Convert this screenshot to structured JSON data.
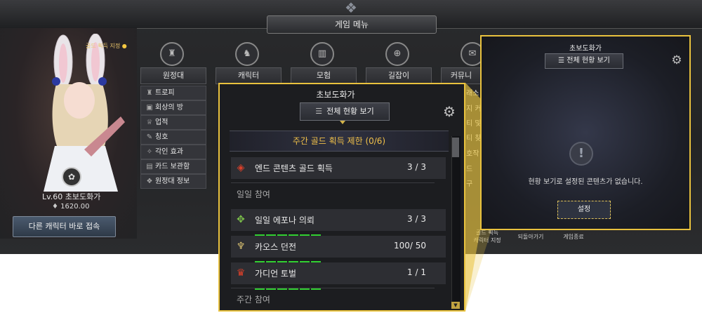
{
  "game_menu": {
    "title": "게임 메뉴",
    "gold_label": "골드 획득 지정",
    "character": {
      "level": "Lv.60 초보도화가",
      "gold": "1620.00",
      "switch_button": "다른 캐릭터 바로 접속"
    },
    "categories": [
      {
        "label": "원정대",
        "icon": "trophy-icon"
      },
      {
        "label": "캐릭터",
        "icon": "helmet-icon"
      },
      {
        "label": "모험",
        "icon": "book-icon"
      },
      {
        "label": "길잡이",
        "icon": "compass-icon"
      },
      {
        "label": "커뮤니",
        "icon": "chat-icon"
      }
    ],
    "expedition_items": [
      {
        "label": "트로피",
        "icon": "trophy-icon"
      },
      {
        "label": "회상의 방",
        "icon": "film-icon"
      },
      {
        "label": "업적",
        "icon": "cup-icon"
      },
      {
        "label": "칭호",
        "icon": "pen-icon"
      },
      {
        "label": "각인 효과",
        "icon": "engrave-icon"
      },
      {
        "label": "카드 보관함",
        "icon": "card-icon"
      },
      {
        "label": "원정대 정보",
        "icon": "crest-icon"
      }
    ],
    "right_edge_items": [
      "래소",
      "지 커",
      "티 및",
      "티 찾",
      "호작",
      "드",
      "구"
    ],
    "bottom_items": [
      "골드 획득\n캐릭터 지정",
      "되돌아가기",
      "게임종료"
    ]
  },
  "main_popup": {
    "title": "초보도화가",
    "overview_button": "전체 현황 보기",
    "weekly_limit": "주간 골드 획득 제한 (0/6)",
    "end_content": {
      "name": "엔드 콘텐츠 골드 획득",
      "count": "3  /  3"
    },
    "daily_section": "일일 참여",
    "daily_rows": [
      {
        "name": "일일 에포나 의뢰",
        "count": "3  /  3",
        "pips": 5,
        "icon_color": "#7cc04a"
      },
      {
        "name": "카오스 던전",
        "count": "100/  50",
        "pips": 5,
        "icon_color": "#d8c070"
      },
      {
        "name": "가디언 토벌",
        "count": "1  /  1",
        "pips": 5,
        "icon_color": "#d9402a"
      }
    ],
    "weekly_section": "주간 참여"
  },
  "side_popup": {
    "title": "초보도화가",
    "overview_button": "전체 현황 보기",
    "message": "현황 보기로 설정된 콘텐츠가 없습니다.",
    "settings_button": "설정"
  },
  "colors": {
    "accent": "#e9c23e",
    "progress": "#31d031",
    "weekly_text": "#f1c14a"
  }
}
